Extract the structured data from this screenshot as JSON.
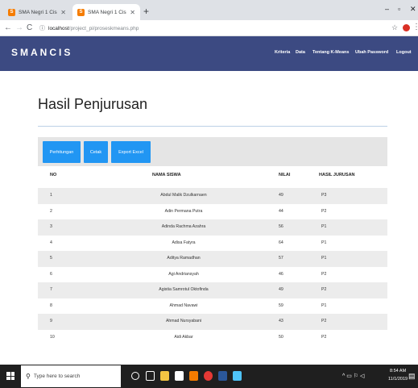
{
  "browser": {
    "tabs": [
      {
        "title": "SMA Negri 1 Cisarua",
        "active": false
      },
      {
        "title": "SMA Negri 1 Cisarua",
        "active": true
      }
    ],
    "url_host": "localhost",
    "url_path": "/project_pi/proseskmeans.php"
  },
  "navbar": {
    "brand": "SMANCIS",
    "links": [
      "Kriteria",
      "Data",
      "Tentang K-Means",
      "Ubah Password",
      "Logout"
    ]
  },
  "page": {
    "title": "Hasil Penjurusan",
    "buttons": [
      "Perhitungan",
      "Cetak",
      "Export Excel"
    ]
  },
  "table": {
    "headers": [
      "NO",
      "NAMA SISWA",
      "NILAI",
      "HASIL JURUSAN"
    ],
    "rows": [
      [
        "1",
        "Abdul Malik Dzulkarnaen",
        "49",
        "P3"
      ],
      [
        "2",
        "Adin Permana Putra",
        "44",
        "P2"
      ],
      [
        "3",
        "Adinda Rachma Azahra",
        "56",
        "P1"
      ],
      [
        "4",
        "Adisa Fatyra",
        "64",
        "P1"
      ],
      [
        "5",
        "Aditya Ramadhan",
        "57",
        "P1"
      ],
      [
        "6",
        "Agi Andriansyah",
        "46",
        "P2"
      ],
      [
        "7",
        "Agistia Samrotul Oktofinda",
        "49",
        "P2"
      ],
      [
        "8",
        "Ahmad Navawi",
        "59",
        "P1"
      ],
      [
        "9",
        "Ahmad Nursyabani",
        "43",
        "P2"
      ],
      [
        "10",
        "Aidi Akbar",
        "50",
        "P2"
      ]
    ]
  },
  "taskbar": {
    "search_placeholder": "Type here to search",
    "time": "8:54 AM",
    "date": "11/1/2019"
  },
  "colors": {
    "navbar": "#3c4a82",
    "button": "#2196f3",
    "stripe": "#ececec"
  }
}
